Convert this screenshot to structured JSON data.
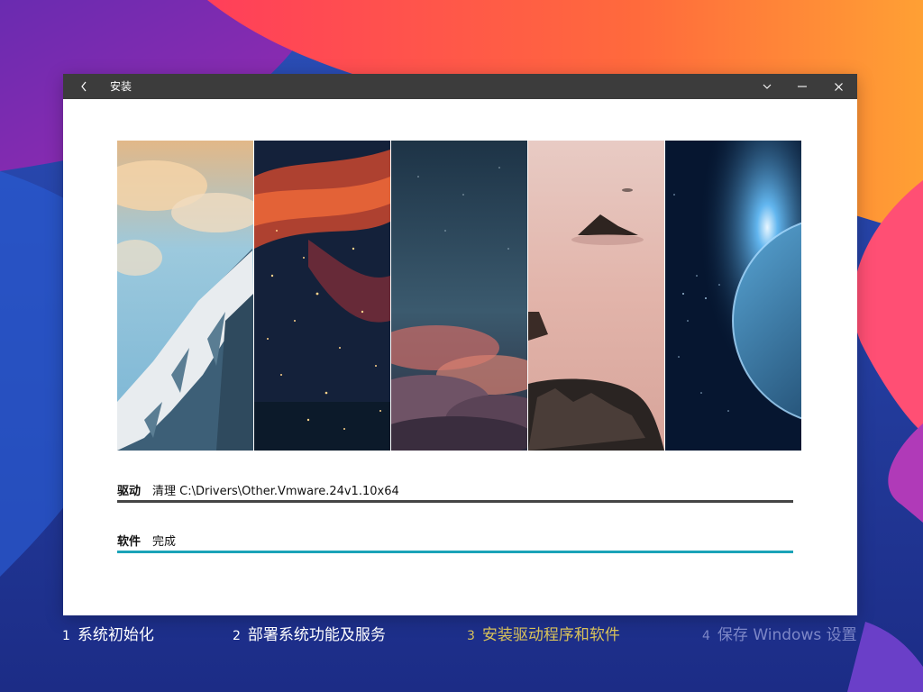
{
  "window": {
    "title": "安装",
    "controls": {
      "back_icon": "chevron-left-icon",
      "menu_icon": "chevron-down-icon",
      "minimize_icon": "minimize-icon",
      "close_icon": "close-icon"
    }
  },
  "gallery": {
    "panels": [
      "snowy-mountain",
      "nebula",
      "cloudy-night-sky",
      "misty-lake-rocks",
      "planet-space"
    ]
  },
  "progress": {
    "driver": {
      "label": "驱动",
      "status": "清理 C:\\Drivers\\Other.Vmware.24v1.10x64",
      "fill": 1.0,
      "color": "#454545"
    },
    "software": {
      "label": "软件",
      "status": "完成",
      "fill": 1.0,
      "color": "#1aa3b8"
    }
  },
  "steps": [
    {
      "number": "1",
      "label": "系统初始化",
      "state": "done",
      "color": "#ffffff"
    },
    {
      "number": "2",
      "label": "部署系统功能及服务",
      "state": "done",
      "color": "#ffffff"
    },
    {
      "number": "3",
      "label": "安装驱动程序和软件",
      "state": "active",
      "color": "#d8c25a"
    },
    {
      "number": "4",
      "label": "保存 Windows 设置",
      "state": "pending",
      "color": "#7d87c7"
    }
  ]
}
